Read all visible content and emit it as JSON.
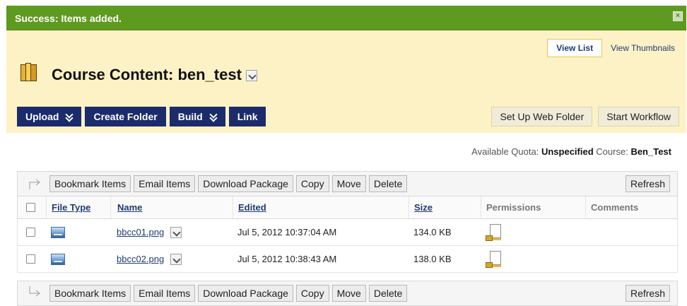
{
  "success": {
    "message": "Success: Items added.",
    "close_icon": "close-icon"
  },
  "view": {
    "list_label": "View List",
    "thumbnails_label": "View Thumbnails"
  },
  "page": {
    "title": "Course Content: ben_test"
  },
  "actions": {
    "upload": "Upload",
    "create_folder": "Create Folder",
    "build": "Build",
    "link": "Link",
    "setup_web_folder": "Set Up Web Folder",
    "start_workflow": "Start Workflow"
  },
  "quota": {
    "available_label": "Available Quota:",
    "available_value": "Unspecified",
    "course_label": "Course:",
    "course_value": "Ben_Test"
  },
  "toolbar": {
    "bookmark": "Bookmark Items",
    "email": "Email Items",
    "download": "Download Package",
    "copy": "Copy",
    "move": "Move",
    "delete": "Delete",
    "refresh": "Refresh"
  },
  "table": {
    "headers": {
      "file_type": "File Type",
      "name": "Name",
      "edited": "Edited",
      "size": "Size",
      "permissions": "Permissions",
      "comments": "Comments"
    },
    "rows": [
      {
        "name": "bbcc01.png",
        "edited": "Jul 5, 2012 10:37:04 AM",
        "size": "134.0 KB",
        "comments": ""
      },
      {
        "name": "bbcc02.png",
        "edited": "Jul 5, 2012 10:38:43 AM",
        "size": "138.0 KB",
        "comments": ""
      }
    ]
  },
  "colors": {
    "success_green": "#5f9a20",
    "header_bg": "#fdf2c5",
    "nav_button": "#1b2b6b",
    "link": "#1f3b72"
  }
}
